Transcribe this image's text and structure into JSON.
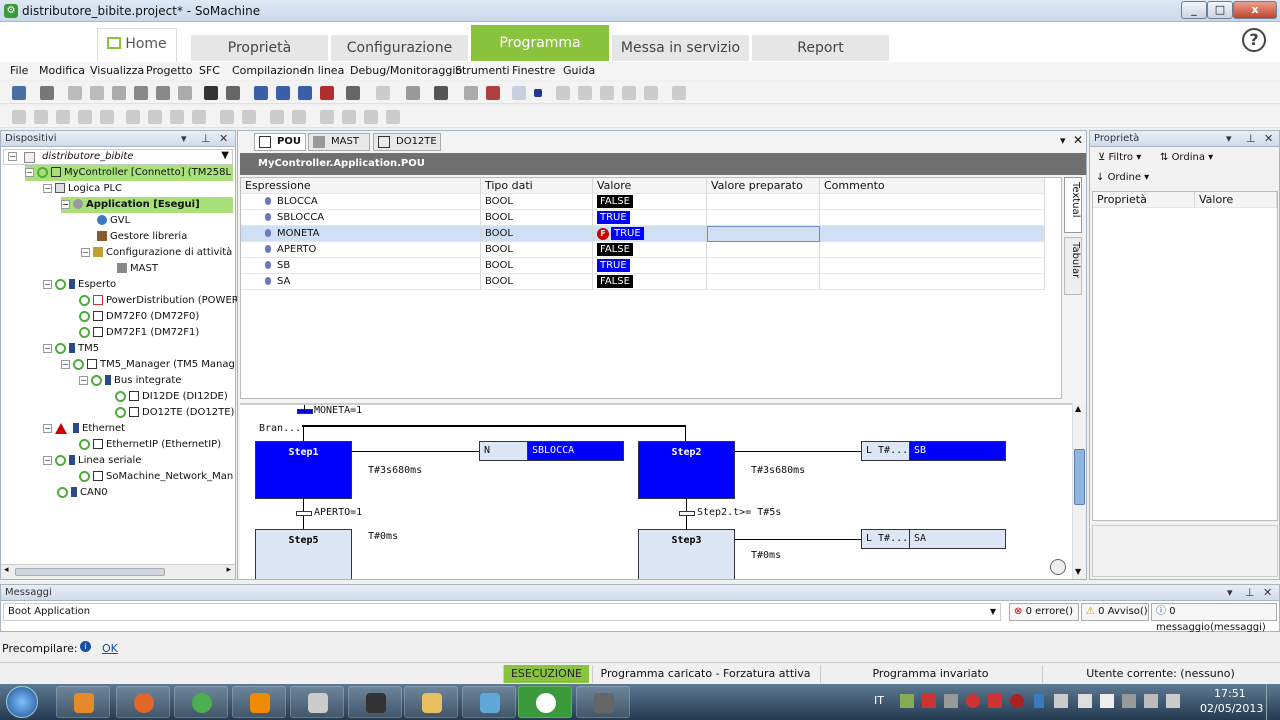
{
  "window": {
    "title": "distributore_bibite.project* - SoMachine",
    "min": "_",
    "max": "□",
    "close": "x"
  },
  "top_tabs": [
    {
      "label": "Home"
    },
    {
      "label": "Proprietà"
    },
    {
      "label": "Configurazione"
    },
    {
      "label": "Programma"
    },
    {
      "label": "Messa in servizio"
    },
    {
      "label": "Report"
    }
  ],
  "help": "?",
  "menu": [
    "File",
    "Modifica",
    "Visualizza",
    "Progetto",
    "SFC",
    "Compilazione",
    "In linea",
    "Debug/Monitoraggio",
    "Strumenti",
    "Finestre",
    "Guida"
  ],
  "devices": {
    "title": "Dispositivi",
    "root": "distributore_bibite",
    "items": [
      {
        "label": "MyController [Connetto] (TM258L"
      },
      {
        "label": "Logica PLC"
      },
      {
        "label": "Application [Esegui]"
      },
      {
        "label": "GVL"
      },
      {
        "label": "Gestore libreria"
      },
      {
        "label": "Configurazione di attività"
      },
      {
        "label": "MAST"
      },
      {
        "label": "Esperto"
      },
      {
        "label": "PowerDistribution (POWER"
      },
      {
        "label": "DM72F0 (DM72F0)"
      },
      {
        "label": "DM72F1 (DM72F1)"
      },
      {
        "label": "TM5"
      },
      {
        "label": "TM5_Manager (TM5 Manag"
      },
      {
        "label": "Bus integrate"
      },
      {
        "label": "DI12DE (DI12DE)"
      },
      {
        "label": "DO12TE (DO12TE)"
      },
      {
        "label": "Ethernet"
      },
      {
        "label": "EthernetIP (EthernetIP)"
      },
      {
        "label": "Linea seriale"
      },
      {
        "label": "SoMachine_Network_Man"
      },
      {
        "label": "CAN0"
      }
    ]
  },
  "editor": {
    "tabs": [
      "POU",
      "MAST",
      "DO12TE"
    ],
    "path": "MyController.Application.POU",
    "columns": [
      "Espressione",
      "Tipo dati",
      "Valore",
      "Valore preparato",
      "Commento"
    ],
    "rows": [
      {
        "expr": "BLOCCA",
        "type": "BOOL",
        "value": "FALSE",
        "forced": false
      },
      {
        "expr": "SBLOCCA",
        "type": "BOOL",
        "value": "TRUE",
        "forced": false
      },
      {
        "expr": "MONETA",
        "type": "BOOL",
        "value": "TRUE",
        "forced": true,
        "force_mark": "F"
      },
      {
        "expr": "APERTO",
        "type": "BOOL",
        "value": "FALSE",
        "forced": false
      },
      {
        "expr": "SB",
        "type": "BOOL",
        "value": "TRUE",
        "forced": false
      },
      {
        "expr": "SA",
        "type": "BOOL",
        "value": "FALSE",
        "forced": false
      }
    ],
    "side_tabs": [
      "Textual",
      "Tabular"
    ],
    "sfc": {
      "branch_label": "Bran...",
      "transition_top": "MONETA=1",
      "step1": {
        "name": "Step1",
        "time": "T#3s680ms",
        "action_q": "N",
        "action_name": "SBLOCCA"
      },
      "step2": {
        "name": "Step2",
        "time": "T#3s680ms",
        "action_q": "L T#...",
        "action_name": "SB"
      },
      "trans1": "APERTO=1",
      "trans2": "Step2.t>= T#5s",
      "step5": {
        "name": "Step5",
        "time": "T#0ms"
      },
      "step3": {
        "name": "Step3",
        "time": "T#0ms",
        "action_q": "L T#...",
        "action_name": "SA"
      }
    }
  },
  "properties": {
    "title": "Proprietà",
    "filter": "Filtro",
    "sort": "Ordina",
    "order": "Ordine",
    "columns": [
      "Proprietà",
      "Valore"
    ]
  },
  "messages": {
    "title": "Messaggi",
    "source": "Boot Application",
    "errors": "0 errore()",
    "warnings": "0 Avviso()",
    "infos": "0 messaggio(messaggi)"
  },
  "precompile": {
    "label": "Precompilare:",
    "status": "OK"
  },
  "status": {
    "state": "ESECUZIONE",
    "program": "Programma caricato - Forzatura attiva",
    "change": "Programma invariato",
    "user": "Utente corrente: (nessuno)"
  },
  "taskbar": {
    "lang": "IT",
    "time": "17:51",
    "date": "02/05/2013"
  },
  "colors": {
    "accent_green": "#8ac43f",
    "active_step": "#0000ff",
    "running_green": "#a8e07a"
  }
}
